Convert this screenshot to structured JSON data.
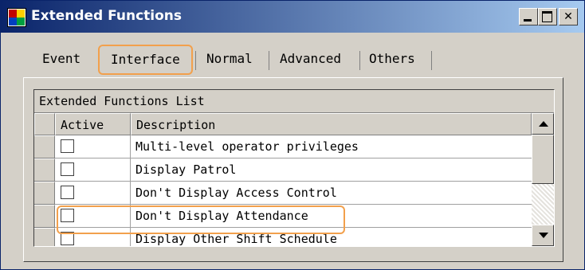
{
  "window": {
    "title": "Extended Functions",
    "controls": [
      "minimize",
      "maximize",
      "close"
    ],
    "close_label": "✕"
  },
  "tabs": [
    {
      "label": "Event",
      "active": false
    },
    {
      "label": "Interface",
      "active": true
    },
    {
      "label": "Normal",
      "active": false
    },
    {
      "label": "Advanced",
      "active": false
    },
    {
      "label": "Others",
      "active": false
    }
  ],
  "grid": {
    "caption": "Extended Functions List",
    "columns": [
      "Active",
      "Description"
    ],
    "rows": [
      {
        "active": false,
        "description": "Multi-level operator privileges"
      },
      {
        "active": false,
        "description": "Display Patrol"
      },
      {
        "active": false,
        "description": "Don't Display Access Control"
      },
      {
        "active": false,
        "description": "Don't Display Attendance"
      },
      {
        "active": false,
        "description": "Display Other Shift Schedule"
      }
    ]
  },
  "colors": {
    "highlight": "#f2a04c",
    "titlebar_start": "#0a246a",
    "titlebar_end": "#a6caf0",
    "face": "#d4d0c8"
  }
}
